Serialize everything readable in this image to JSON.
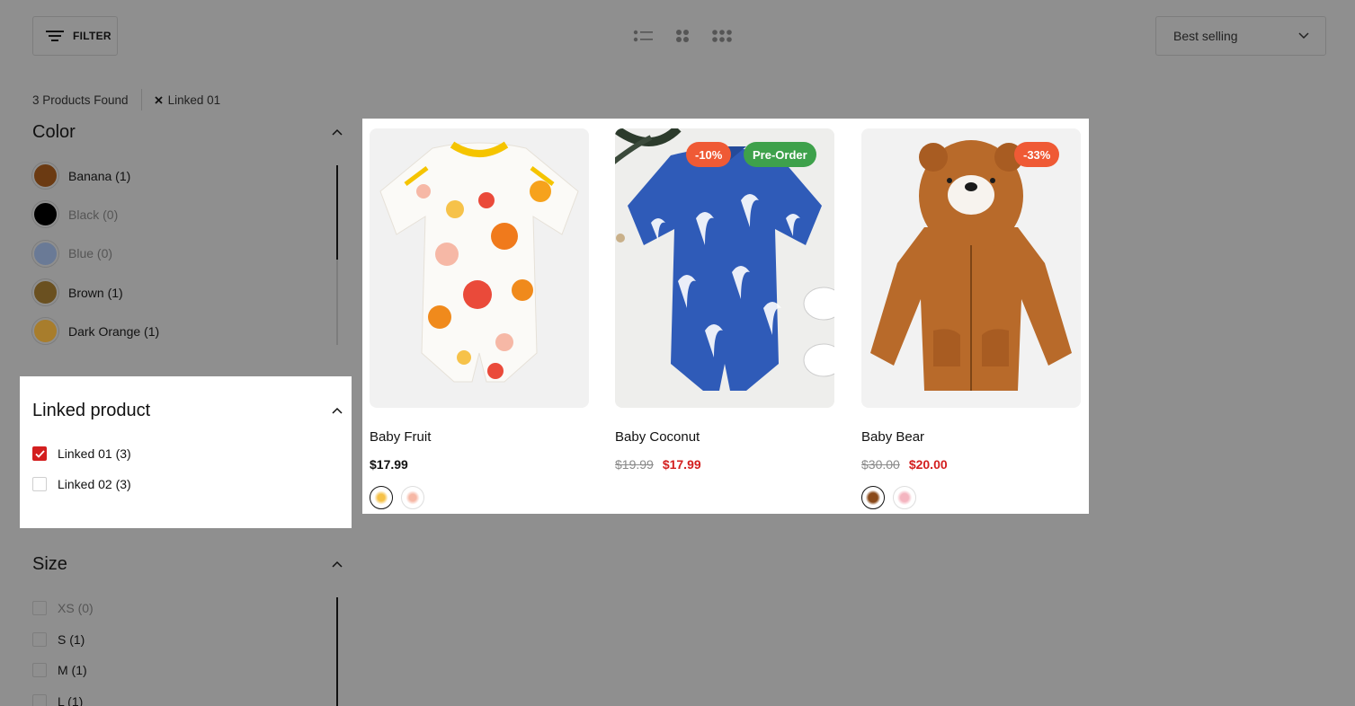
{
  "toolbar": {
    "filter_label": "FILTER",
    "sort_selected": "Best selling"
  },
  "results": {
    "count_text": "3 Products Found",
    "active_filter": "Linked 01"
  },
  "color_filter": {
    "title": "Color",
    "items": [
      {
        "label": "Banana (1)",
        "color": "#6b3a12"
      },
      {
        "label": "Black (0)",
        "color": "#000000"
      },
      {
        "label": "Blue (0)",
        "color": "#6a7a96"
      },
      {
        "label": "Brown (1)",
        "color": "#6a5020"
      },
      {
        "label": "Dark Orange (1)",
        "color": "#a87d2c"
      }
    ]
  },
  "linked_filter": {
    "title": "Linked product",
    "items": [
      {
        "label": "Linked 01 (3)",
        "checked": true
      },
      {
        "label": "Linked 02 (3)",
        "checked": false
      }
    ]
  },
  "size_filter": {
    "title": "Size",
    "items": [
      {
        "label": "XS (0)"
      },
      {
        "label": "S (1)"
      },
      {
        "label": "M (1)"
      },
      {
        "label": "L (1)"
      }
    ]
  },
  "products": [
    {
      "name": "Baby Fruit",
      "price": "$17.99",
      "old_price": "",
      "badges": []
    },
    {
      "name": "Baby Coconut",
      "price": "$17.99",
      "old_price": "$19.99",
      "badges": [
        "-10%",
        "Pre-Order"
      ]
    },
    {
      "name": "Baby Bear",
      "price": "$20.00",
      "old_price": "$30.00",
      "badges": [
        "-33%"
      ]
    }
  ],
  "colors": {
    "sale_red": "#d31f1f",
    "badge_orange": "#ef5a35",
    "badge_green": "#3ea14b",
    "overlay_gray": "#8f8f8f"
  },
  "icons": [
    "filter-lines-icon",
    "list-view-icon",
    "grid-2-icon",
    "grid-3-icon",
    "chevron-down-icon",
    "chevron-up-icon",
    "close-icon",
    "checkmark-icon"
  ]
}
